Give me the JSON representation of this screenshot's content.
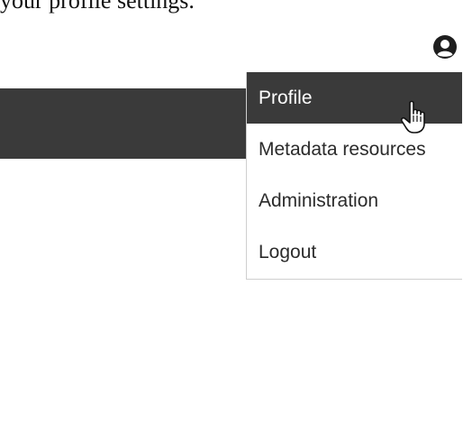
{
  "page": {
    "intro_text": "your profile settings."
  },
  "header": {
    "user_icon": "user-circle-icon"
  },
  "user_menu": {
    "items": [
      {
        "label": "Profile",
        "active": true
      },
      {
        "label": "Metadata resources",
        "active": false
      },
      {
        "label": "Administration",
        "active": false
      },
      {
        "label": "Logout",
        "active": false
      }
    ]
  },
  "cursor": {
    "icon": "hand-pointer-icon"
  },
  "colors": {
    "bar_dark": "#3a3a3a",
    "menu_border": "#cfcfcf",
    "text": "#2b2b2b"
  }
}
